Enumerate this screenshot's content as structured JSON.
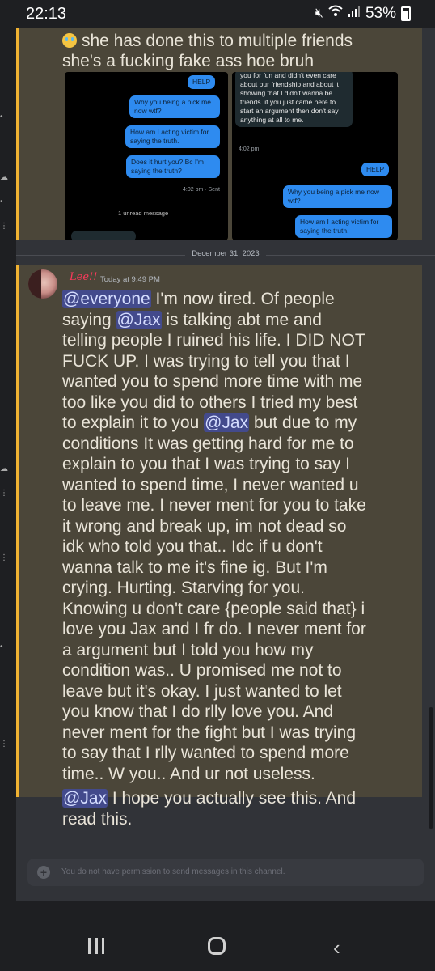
{
  "status": {
    "time": "22:13",
    "battery": "53%"
  },
  "top_message": {
    "line1": "she has done this to multiple friends",
    "line2": "she's a fucking fake ass hoe bruh"
  },
  "screenshot_1": {
    "help": "HELP",
    "bubble_a": "Why you being a pick me now wtf?",
    "bubble_b": "How am I acting victim for saying the truth.",
    "bubble_c": "Does it hurt you? Bc I'm saying the truth?",
    "sent_time": "4:02 pm · Sent",
    "unread": "1 unread message"
  },
  "screenshot_2": {
    "grey_bubble": "you for fun and didn't even care about our friendship and about it showing that I didn't wanna be friends. if you just came here to start an argument then don't say anything at all to me.",
    "grey_time": "4:02 pm",
    "help": "HELP",
    "bubble_a": "Why you being a pick me now wtf?",
    "bubble_b": "How am I acting victim for saying the truth."
  },
  "date_divider": "December 31, 2023",
  "main_message": {
    "username": "Lee!!",
    "timestamp": "Today at 9:49 PM",
    "mention_everyone": "@everyone",
    "mention_jax": "@Jax",
    "lines": [
      " I'm now tired. Of people",
      "saying ",
      " is talking abt me and",
      "telling people I ruined his life. I DID NOT",
      "FUCK UP. I was trying to tell you that I",
      "wanted you to spend more time with me",
      "too like you did to others I tried my best",
      "to explain it to you ",
      " but due to my",
      "conditions It was getting hard for me to",
      "explain to you that I was trying to say I",
      "wanted to spend time, I never wanted u",
      "to leave me. I never ment for you to take",
      "it wrong and break up, im not dead so",
      "idk who told you that.. Idc if u don't",
      "wanna talk to me it's fine ig. But I'm",
      "crying. Hurting. Starving for you.",
      "Knowing u don't care {people said that} i",
      "love you Jax and I fr do. I never ment for",
      "a argument but I told you how my",
      "condition was.. U promised me not to",
      "leave but it's okay. I just wanted to let",
      "you know that I do rlly love you. And",
      "never ment for the fight but I was trying",
      "to say that I rlly wanted to spend more",
      "time.. W you.. And ur not useless."
    ],
    "followup_mention": "@Jax",
    "followup_line1": " I hope you actually see this. And",
    "followup_line2": "read this."
  },
  "input": {
    "placeholder": "You do not have permission to send messages in this channel."
  },
  "icons": {
    "mute": "mute-icon",
    "wifi": "wifi-icon",
    "signal": "signal-icon",
    "battery": "battery-icon"
  },
  "colors": {
    "mention_highlight": "#4b4639",
    "mention_bar": "#f0b232",
    "mention_pill": "#434a8c",
    "username": "#ff3a5c"
  }
}
